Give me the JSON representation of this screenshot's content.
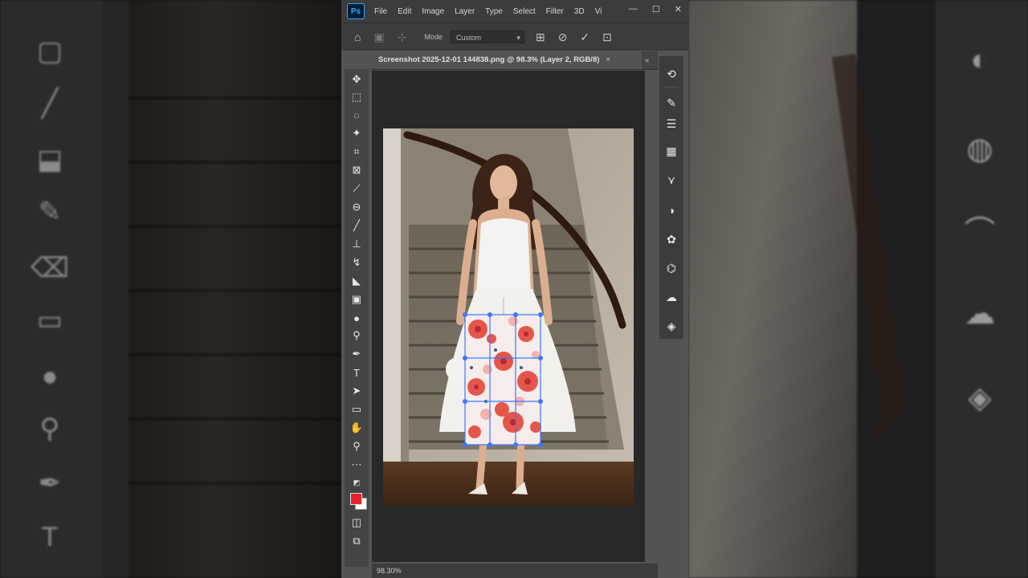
{
  "app": {
    "logo": "Ps",
    "menu": [
      "File",
      "Edit",
      "Image",
      "Layer",
      "Type",
      "Select",
      "Filter",
      "3D",
      "Vi"
    ],
    "window_controls": [
      "—",
      "☐",
      "✕"
    ]
  },
  "options_bar": {
    "mode_label": "Mode",
    "mode_value": "Custom"
  },
  "document": {
    "tab_title": "Screenshot 2025-12-01 144838.png @ 98.3% (Layer 2, RGB/8)",
    "close_symbol": "×",
    "collapse_symbol": "«"
  },
  "status_bar": {
    "zoom": "98.30%"
  },
  "colors": {
    "foreground": "#e8212b",
    "background": "#ffffff",
    "accent": "#31a8ff",
    "selection_handles": "#3a78ff"
  },
  "icons": {
    "left_toolbar": [
      "move-icon",
      "marquee-icon",
      "lasso-icon",
      "magic-wand-icon",
      "crop-icon",
      "frame-icon",
      "eyedropper-icon",
      "spot-healing-icon",
      "brush-icon",
      "clone-stamp-icon",
      "history-brush-icon",
      "eraser-icon",
      "gradient-icon",
      "blur-icon",
      "dodge-icon",
      "pen-icon",
      "type-icon",
      "path-selection-icon",
      "rectangle-icon",
      "hand-icon",
      "zoom-icon",
      "more-tools-icon"
    ],
    "right_panel": [
      "history-icon",
      "brushes-icon",
      "adjustments-icon",
      "swatches-icon",
      "paths-icon",
      "color-icon",
      "properties-icon",
      "navigator-icon",
      "channels-icon",
      "libraries-icon",
      "layers-icon"
    ]
  }
}
